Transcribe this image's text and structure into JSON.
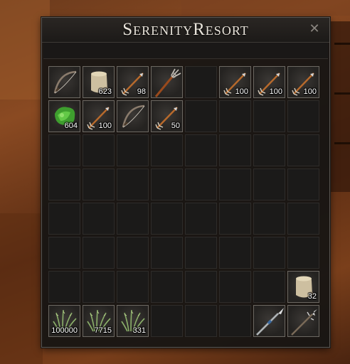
{
  "window": {
    "title": "SerenityResort",
    "close_icon": "close-icon"
  },
  "inventory": {
    "columns": 8,
    "rows": 8,
    "items": [
      {
        "slot": 0,
        "icon": "bow",
        "count": ""
      },
      {
        "slot": 1,
        "icon": "sack",
        "count": "623"
      },
      {
        "slot": 2,
        "icon": "arrow",
        "count": "98"
      },
      {
        "slot": 3,
        "icon": "trident",
        "count": ""
      },
      {
        "slot": 5,
        "icon": "arrow",
        "count": "100"
      },
      {
        "slot": 6,
        "icon": "arrow",
        "count": "100"
      },
      {
        "slot": 7,
        "icon": "arrow",
        "count": "100"
      },
      {
        "slot": 8,
        "icon": "green-leaves",
        "count": "604"
      },
      {
        "slot": 9,
        "icon": "arrow",
        "count": "100"
      },
      {
        "slot": 10,
        "icon": "bow",
        "count": ""
      },
      {
        "slot": 11,
        "icon": "arrow",
        "count": "50"
      },
      {
        "slot": 55,
        "icon": "sack",
        "count": "32"
      },
      {
        "slot": 56,
        "icon": "grass",
        "count": "100000"
      },
      {
        "slot": 57,
        "icon": "grass",
        "count": "7715"
      },
      {
        "slot": 58,
        "icon": "grass",
        "count": "331"
      },
      {
        "slot": 62,
        "icon": "spear",
        "count": ""
      },
      {
        "slot": 63,
        "icon": "harpoon",
        "count": ""
      }
    ]
  }
}
